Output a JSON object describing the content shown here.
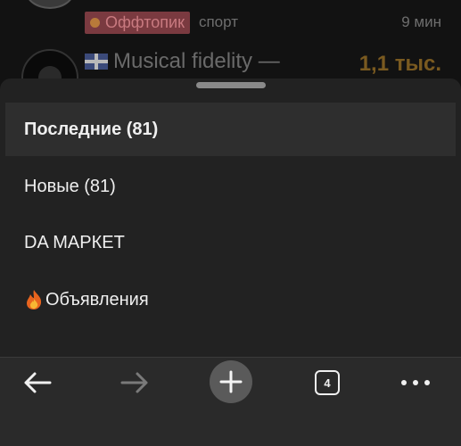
{
  "background_list": {
    "row1": {
      "category": "Оффтопик",
      "tag": "спорт",
      "time": "9 мин"
    },
    "row2": {
      "title": "Musical fidelity —",
      "views": "1,1 тыс."
    }
  },
  "menu": {
    "items": [
      {
        "label": "Последние (81)",
        "active": true
      },
      {
        "label": "Новые (81)"
      },
      {
        "label": "DA МАРКЕТ"
      },
      {
        "label": "Объявления"
      }
    ]
  },
  "toolbar": {
    "back_icon": "arrow-left-icon",
    "forward_icon": "arrow-right-icon",
    "new_tab_icon": "plus-icon",
    "tab_count": "4",
    "more_icon": "ellipsis-icon"
  },
  "colors": {
    "sheet": "#222222",
    "active_row": "#2e2e2e",
    "badge": "#7a3a40",
    "views": "#7a5a20"
  }
}
